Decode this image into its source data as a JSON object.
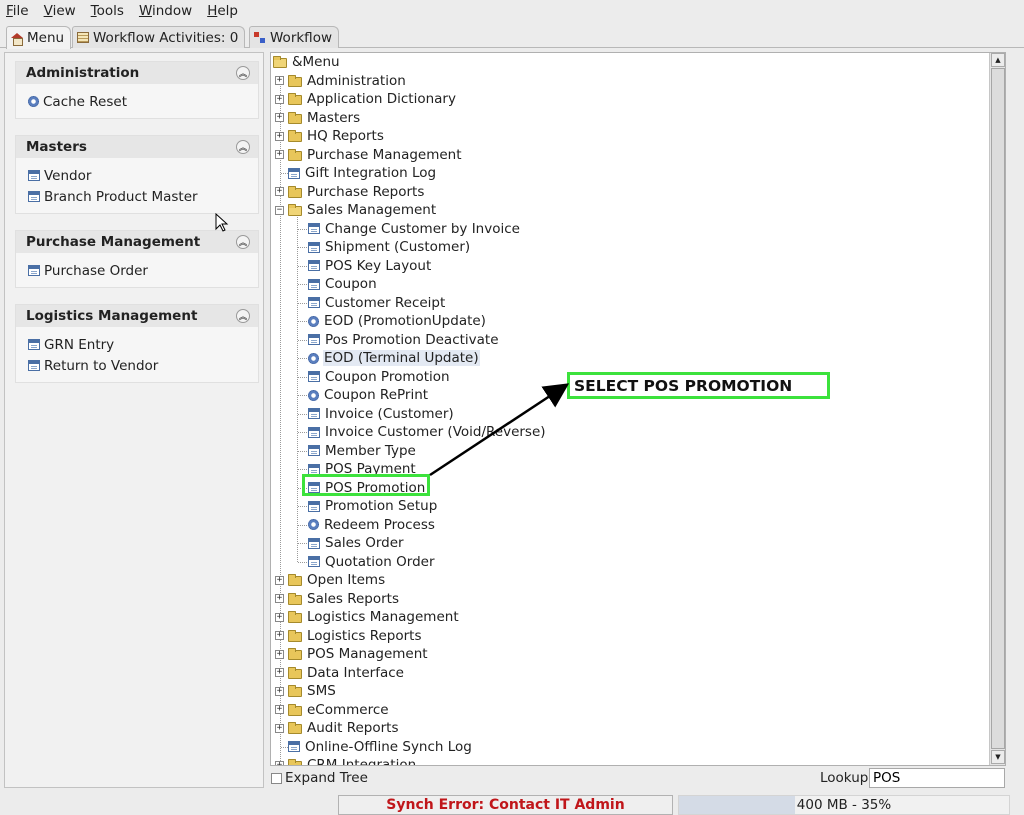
{
  "menubar": {
    "items": [
      "File",
      "View",
      "Tools",
      "Window",
      "Help"
    ]
  },
  "tabs": [
    {
      "label": "Menu",
      "icon": "home-icon"
    },
    {
      "label": "Workflow Activities: 0",
      "icon": "table-icon"
    },
    {
      "label": "Workflow",
      "icon": "workflow-icon"
    }
  ],
  "left_panel": {
    "groups": [
      {
        "title": "Administration",
        "items": [
          {
            "label": "Cache Reset",
            "icon": "process-icon"
          }
        ]
      },
      {
        "title": "Masters",
        "items": [
          {
            "label": "Vendor",
            "icon": "window-icon"
          },
          {
            "label": "Branch Product Master",
            "icon": "window-icon"
          }
        ]
      },
      {
        "title": "Purchase Management",
        "items": [
          {
            "label": "Purchase Order",
            "icon": "window-icon"
          }
        ]
      },
      {
        "title": "Logistics Management",
        "items": [
          {
            "label": "GRN Entry",
            "icon": "window-icon"
          },
          {
            "label": "Return to Vendor",
            "icon": "window-icon"
          }
        ]
      }
    ]
  },
  "tree": {
    "root": "&Menu",
    "top_nodes_before": [
      {
        "label": "Administration",
        "type": "folder"
      },
      {
        "label": "Application Dictionary",
        "type": "folder"
      },
      {
        "label": "Masters",
        "type": "folder"
      },
      {
        "label": "HQ Reports",
        "type": "folder"
      },
      {
        "label": "Purchase Management",
        "type": "folder"
      },
      {
        "label": "Gift Integration Log",
        "type": "window"
      },
      {
        "label": "Purchase Reports",
        "type": "folder"
      },
      {
        "label": "Sales Management",
        "type": "folder-open"
      }
    ],
    "sales_children": [
      {
        "label": "Change Customer by Invoice",
        "type": "window"
      },
      {
        "label": "Shipment (Customer)",
        "type": "window"
      },
      {
        "label": "POS Key Layout",
        "type": "window"
      },
      {
        "label": "Coupon",
        "type": "window"
      },
      {
        "label": "Customer Receipt",
        "type": "window"
      },
      {
        "label": "EOD (PromotionUpdate)",
        "type": "process"
      },
      {
        "label": "Pos Promotion Deactivate",
        "type": "window"
      },
      {
        "label": "EOD (Terminal Update)",
        "type": "process"
      },
      {
        "label": "Coupon Promotion",
        "type": "window"
      },
      {
        "label": "Coupon RePrint",
        "type": "process"
      },
      {
        "label": "Invoice (Customer)",
        "type": "window"
      },
      {
        "label": "Invoice Customer (Void/Reverse)",
        "type": "window"
      },
      {
        "label": "Member Type",
        "type": "window"
      },
      {
        "label": "POS Payment",
        "type": "window"
      },
      {
        "label": "POS Promotion",
        "type": "window"
      },
      {
        "label": "Promotion Setup",
        "type": "window"
      },
      {
        "label": "Redeem Process",
        "type": "process"
      },
      {
        "label": "Sales Order",
        "type": "window"
      },
      {
        "label": "Quotation Order",
        "type": "window"
      }
    ],
    "top_nodes_after": [
      {
        "label": "Open Items",
        "type": "folder"
      },
      {
        "label": "Sales Reports",
        "type": "folder"
      },
      {
        "label": "Logistics Management",
        "type": "folder"
      },
      {
        "label": "Logistics Reports",
        "type": "folder"
      },
      {
        "label": "POS Management",
        "type": "folder"
      },
      {
        "label": "Data Interface",
        "type": "folder"
      },
      {
        "label": "SMS",
        "type": "folder"
      },
      {
        "label": "eCommerce",
        "type": "folder"
      },
      {
        "label": "Audit Reports",
        "type": "folder"
      },
      {
        "label": "Online-Offline Synch Log",
        "type": "window"
      },
      {
        "label": "CRM Integration",
        "type": "folder"
      }
    ],
    "selected": "EOD (Terminal Update)"
  },
  "footer": {
    "expand_tree_label": "Expand Tree",
    "lookup_label": "Lookup",
    "lookup_value": "POS"
  },
  "status": {
    "synch_error": "Synch Error: Contact IT Admin",
    "memory_text": "400 MB - 35%",
    "memory_fraction": 0.35
  },
  "annotation": {
    "callout_text": "SELECT POS PROMOTION",
    "highlight_color": "#3ce23c"
  }
}
